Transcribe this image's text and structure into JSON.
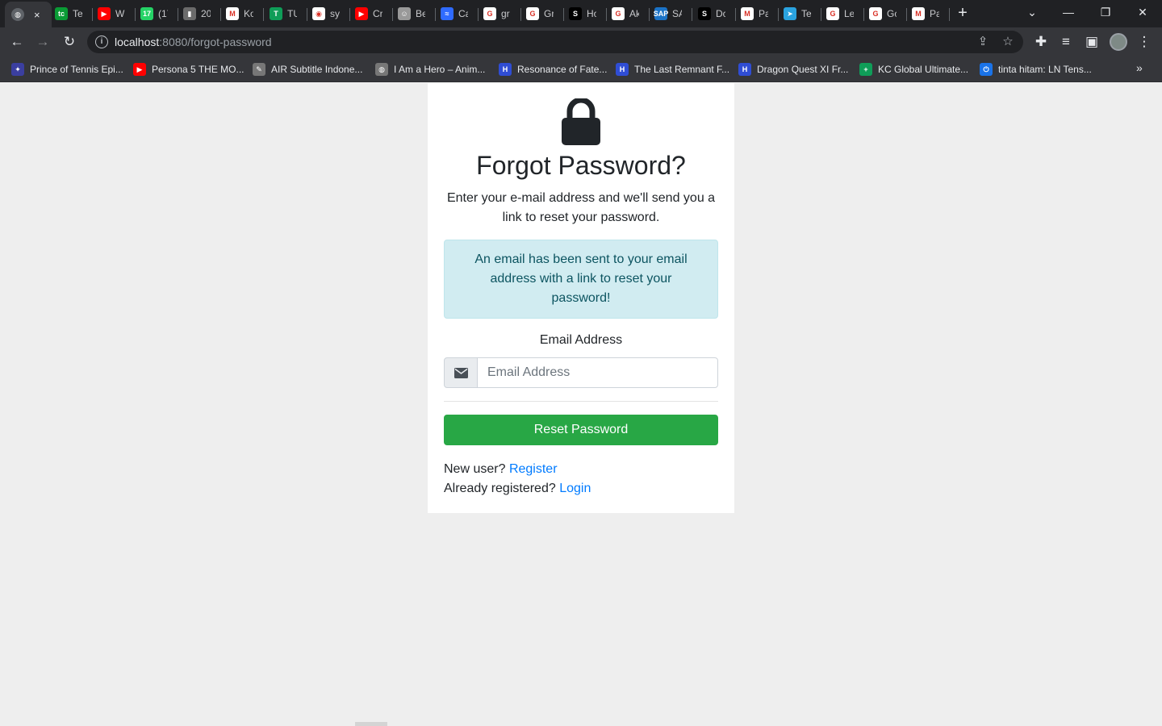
{
  "browser": {
    "active_tab": {
      "icon": "globe-icon",
      "close": "×"
    },
    "tabs": [
      {
        "title": "Te",
        "icon": "codesandbox-tc-icon",
        "color": "#0a9b35",
        "glyph": "tc"
      },
      {
        "title": "W",
        "icon": "youtube-icon",
        "color": "#ff0000",
        "glyph": "▶"
      },
      {
        "title": "(17",
        "icon": "whatsapp-icon",
        "color": "#25d366",
        "glyph": "17"
      },
      {
        "title": "20",
        "icon": "document-icon",
        "color": "#6b6b6b",
        "glyph": "▮"
      },
      {
        "title": "Ko",
        "icon": "gmail-icon",
        "color": "#ffffff",
        "glyph": "M"
      },
      {
        "title": "TU",
        "icon": "green-plus-icon",
        "color": "#0f9d58",
        "glyph": "T"
      },
      {
        "title": "sy",
        "icon": "github-icon",
        "color": "#ffffff",
        "glyph": "◉"
      },
      {
        "title": "Cr",
        "icon": "youtube-icon",
        "color": "#ff0000",
        "glyph": "▶"
      },
      {
        "title": "Be",
        "icon": "face-icon",
        "color": "#999999",
        "glyph": "☺"
      },
      {
        "title": "Ca",
        "icon": "chart-icon",
        "color": "#2f6bff",
        "glyph": "≈"
      },
      {
        "title": "gr",
        "icon": "google-icon",
        "color": "#ffffff",
        "glyph": "G"
      },
      {
        "title": "Gr",
        "icon": "google-icon",
        "color": "#ffffff",
        "glyph": "G"
      },
      {
        "title": "Ho",
        "icon": "s-logo-icon",
        "color": "#000000",
        "glyph": "S"
      },
      {
        "title": "Ak",
        "icon": "google-icon",
        "color": "#ffffff",
        "glyph": "G"
      },
      {
        "title": "SA",
        "icon": "sap-icon",
        "color": "#1b73c7",
        "glyph": "SAP"
      },
      {
        "title": "Dc",
        "icon": "s-logo-icon",
        "color": "#000000",
        "glyph": "S"
      },
      {
        "title": "Pa",
        "icon": "gmail-icon",
        "color": "#ffffff",
        "glyph": "M"
      },
      {
        "title": "Te",
        "icon": "telegram-icon",
        "color": "#2aa3e0",
        "glyph": "➤"
      },
      {
        "title": "Le",
        "icon": "google-icon",
        "color": "#ffffff",
        "glyph": "G"
      },
      {
        "title": "Gc",
        "icon": "google-icon",
        "color": "#ffffff",
        "glyph": "G"
      },
      {
        "title": "Pa",
        "icon": "gmail-icon",
        "color": "#ffffff",
        "glyph": "M"
      }
    ],
    "new_tab": "+",
    "window_controls": {
      "tab_search": "⌄",
      "minimize": "—",
      "restore": "❐",
      "close": "✕"
    },
    "toolbar": {
      "back": "←",
      "forward": "→",
      "reload": "↻"
    },
    "address": {
      "host": "localhost",
      "path": ":8080/forgot-password"
    },
    "bookmarks": [
      {
        "label": "Prince of Tennis Epi...",
        "icon": "anime-icon",
        "color": "#3b3fa0",
        "glyph": "✦"
      },
      {
        "label": "Persona 5 THE MO...",
        "icon": "youtube-icon",
        "color": "#ff0000",
        "glyph": "▶"
      },
      {
        "label": "AIR Subtitle Indone...",
        "icon": "pen-icon",
        "color": "#777777",
        "glyph": "✎"
      },
      {
        "label": "I Am a Hero – Anim...",
        "icon": "globe-icon",
        "color": "#777777",
        "glyph": "◍"
      },
      {
        "label": "Resonance of Fate...",
        "icon": "h-logo-icon",
        "color": "#2f4dd4",
        "glyph": "H"
      },
      {
        "label": "The Last Remnant F...",
        "icon": "h-logo-icon",
        "color": "#2f4dd4",
        "glyph": "H"
      },
      {
        "label": "Dragon Quest XI Fr...",
        "icon": "h-logo-icon",
        "color": "#2f4dd4",
        "glyph": "H"
      },
      {
        "label": "KC Global Ultimate...",
        "icon": "green-plus-icon",
        "color": "#0f9d58",
        "glyph": "+"
      },
      {
        "label": "tinta hitam: LN Tens...",
        "icon": "power-icon",
        "color": "#1a73e8",
        "glyph": "⏻"
      }
    ],
    "bookmarks_more": "»"
  },
  "page": {
    "title": "Forgot Password?",
    "subtitle": "Enter your e-mail address and we'll send you a link to reset your password.",
    "alert": "An email has been sent to your email address with a link to reset your password!",
    "email_label": "Email Address",
    "email_placeholder": "Email Address",
    "email_value": "",
    "submit_label": "Reset Password",
    "new_user_text": "New user?",
    "register_link": "Register",
    "registered_text": "Already registered?",
    "login_link": "Login"
  },
  "colors": {
    "page_bg": "#eeeeee",
    "card_bg": "#ffffff",
    "alert_bg": "#d1ecf1",
    "alert_text": "#0c5460",
    "button_bg": "#28a745",
    "link": "#007bff"
  }
}
